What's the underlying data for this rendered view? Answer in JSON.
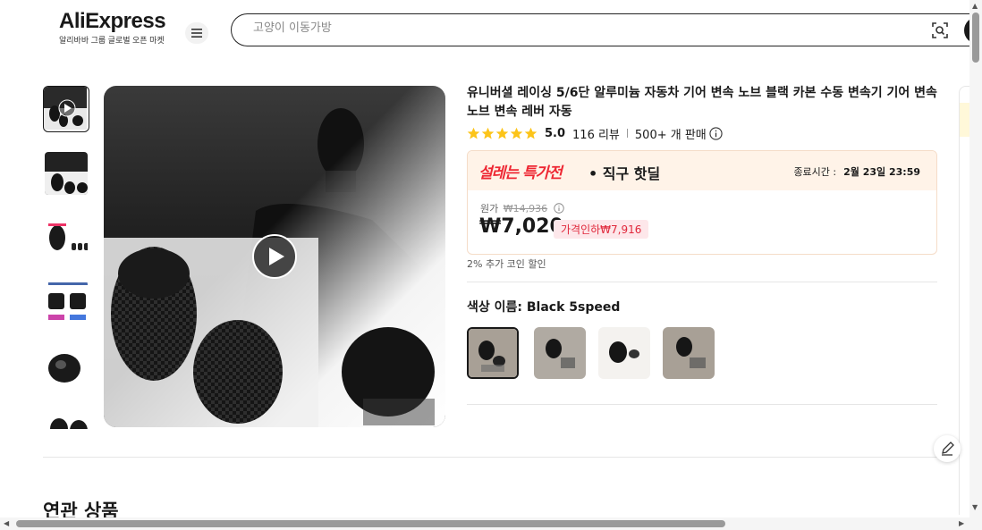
{
  "header": {
    "logo_text": "AliExpress",
    "logo_subtitle": "알리바바 그룹 글로벌 오픈 마켓",
    "search_placeholder": "고양이 이동가방"
  },
  "product": {
    "title": "유니버셜 레이싱 5/6단 알루미늄 자동차 기어 변속 노브 블랙 카본 수동 변속기 기어 변속 노브 변속 레버 자동",
    "rating": "5.0",
    "reviews": "116 리뷰",
    "sold": "500+ 개 판매",
    "stars": 5
  },
  "deal": {
    "brand": "설레는 특가전",
    "subtitle": "• 직구 핫딜",
    "end_label": "종료시간 :",
    "end_time": "2월 23일 23:59",
    "original_label": "원가",
    "original_price": "₩14,936",
    "price": "₩7,020",
    "discount": "가격인하₩7,916",
    "coin_text": "2% 추가 코인 할인"
  },
  "options": {
    "color_label": "색상 이름: Black 5speed"
  },
  "sections": {
    "related_title": "연관 상품"
  },
  "colors": {
    "accent": "#ee2733",
    "deal_bg": "#fff3e8",
    "badge_bg": "#fde7ea",
    "star": "#fcc419"
  }
}
